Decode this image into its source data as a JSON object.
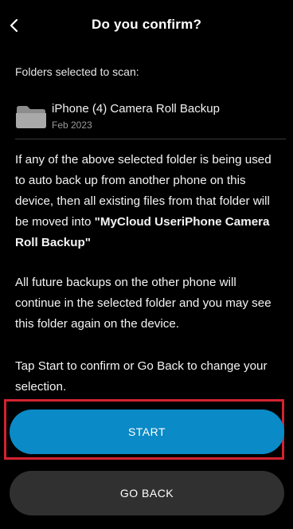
{
  "header": {
    "title": "Do you confirm?",
    "back_icon": "chevron-left-icon"
  },
  "folders": {
    "label": "Folders selected to scan:",
    "items": [
      {
        "name": "iPhone (4) Camera Roll Backup",
        "date": "Feb 2023",
        "icon": "folder-icon"
      }
    ]
  },
  "message": {
    "p1_text": "If any of the above selected folder is being used to auto back up from another phone on this device, then all existing files from that folder will be moved into ",
    "p1_destination": "\"MyCloud UseriPhone Camera Roll Backup\"",
    "p2": "All future backups on the other phone will continue in the selected folder and you may see this folder again on the device.",
    "p3": "Tap Start to confirm or Go Back to change your selection."
  },
  "actions": {
    "start_label": "START",
    "go_back_label": "GO BACK"
  },
  "colors": {
    "background": "#000000",
    "primary_button": "#0a8ac6",
    "secondary_button": "#303030",
    "highlight_outline": "#d32330"
  }
}
